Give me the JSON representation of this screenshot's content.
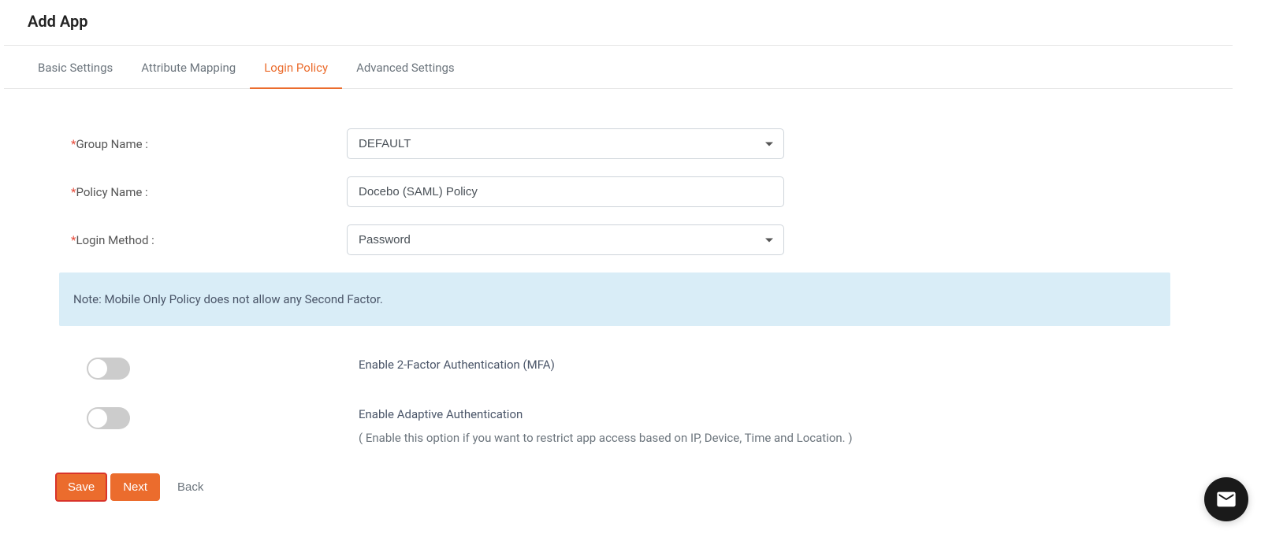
{
  "header": {
    "title": "Add App"
  },
  "tabs": [
    {
      "label": "Basic Settings",
      "active": false
    },
    {
      "label": "Attribute Mapping",
      "active": false
    },
    {
      "label": "Login Policy",
      "active": true
    },
    {
      "label": "Advanced Settings",
      "active": false
    }
  ],
  "form": {
    "group_name": {
      "label": "Group Name :",
      "value": "DEFAULT"
    },
    "policy_name": {
      "label": "Policy Name :",
      "value": "Docebo (SAML) Policy"
    },
    "login_method": {
      "label": "Login Method :",
      "value": "Password"
    },
    "note": "Note: Mobile Only Policy does not allow any Second Factor.",
    "mfa": {
      "label": "Enable 2-Factor Authentication (MFA)"
    },
    "adaptive": {
      "label": "Enable Adaptive Authentication",
      "sublabel": "( Enable this option if you want to restrict app access based on IP, Device, Time and Location. )"
    }
  },
  "buttons": {
    "save": "Save",
    "next": "Next",
    "back": "Back"
  }
}
